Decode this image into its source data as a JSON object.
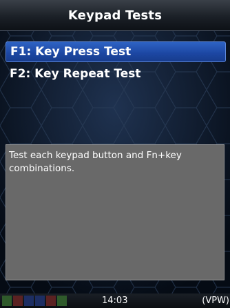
{
  "header": {
    "title": "Keypad Tests"
  },
  "menu": {
    "items": [
      {
        "label": "F1: Key Press Test",
        "selected": true
      },
      {
        "label": "F2: Key Repeat Test",
        "selected": false
      }
    ]
  },
  "description": {
    "text": "Test each keypad button and Fn+key combinations."
  },
  "statusbar": {
    "indicators": [
      {
        "name": "indicator-green-1",
        "color": "#2f5a2b"
      },
      {
        "name": "indicator-red",
        "color": "#5b2222"
      },
      {
        "name": "indicator-blue-1",
        "color": "#1d2e63"
      },
      {
        "name": "indicator-blue-2",
        "color": "#1d2e63"
      },
      {
        "name": "indicator-red-2",
        "color": "#5b2222"
      },
      {
        "name": "indicator-green-2",
        "color": "#2f5a2b"
      }
    ],
    "time": "14:03",
    "mode": "(VPW)"
  },
  "colors": {
    "background": "#0b1626",
    "selection": "#2e63c4",
    "panel": "#696969"
  }
}
